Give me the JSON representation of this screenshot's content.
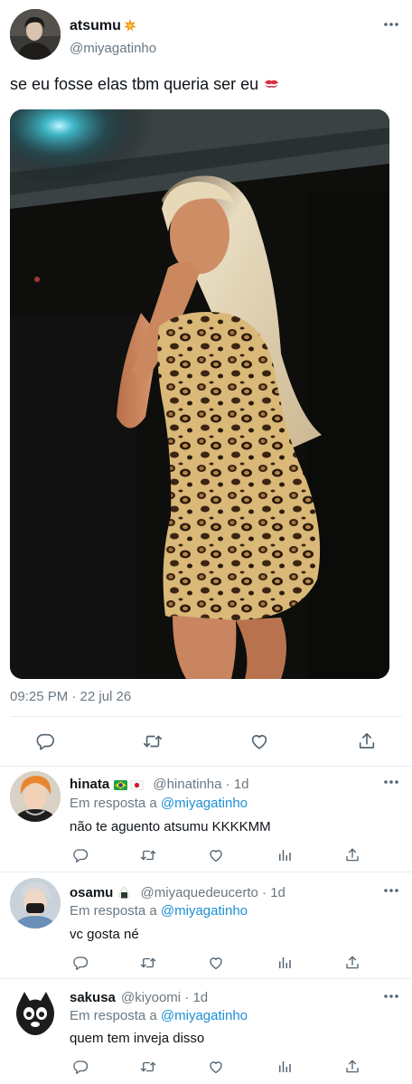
{
  "main_tweet": {
    "display_name": "atsumu",
    "name_emoji": "collision-emoji",
    "handle": "@miyagatinho",
    "text": "se eu fosse elas tbm queria ser eu",
    "text_emoji": "kiss-mark-emoji",
    "timestamp": "09:25 PM · 22 jul 26",
    "icons": [
      "reply-icon",
      "retweet-icon",
      "like-icon",
      "share-icon"
    ]
  },
  "replies": [
    {
      "display_name": "hinata",
      "name_emojis": [
        "brazil-flag-emoji",
        "japan-flag-emoji"
      ],
      "handle": "@hinatinha",
      "separator": "·",
      "time": "1d",
      "reply_prefix": "Em resposta a",
      "reply_to": "@miyagatinho",
      "text": "não te aguento atsumu KKKKMM"
    },
    {
      "display_name": "osamu",
      "name_emojis": [
        "rice-ball-emoji"
      ],
      "handle": "@miyaquedeucerto",
      "separator": "·",
      "time": "1d",
      "reply_prefix": "Em resposta a",
      "reply_to": "@miyagatinho",
      "text": "vc gosta né"
    },
    {
      "display_name": "sakusa",
      "name_emojis": [],
      "handle": "@kiyoomi",
      "separator": "·",
      "time": "1d",
      "reply_prefix": "Em resposta a",
      "reply_to": "@miyagatinho",
      "text": "quem tem inveja disso"
    }
  ],
  "colors": {
    "text": "#0f1419",
    "secondary": "#6b7883",
    "link": "#1b8fd6",
    "divider": "#e6ecf0"
  }
}
